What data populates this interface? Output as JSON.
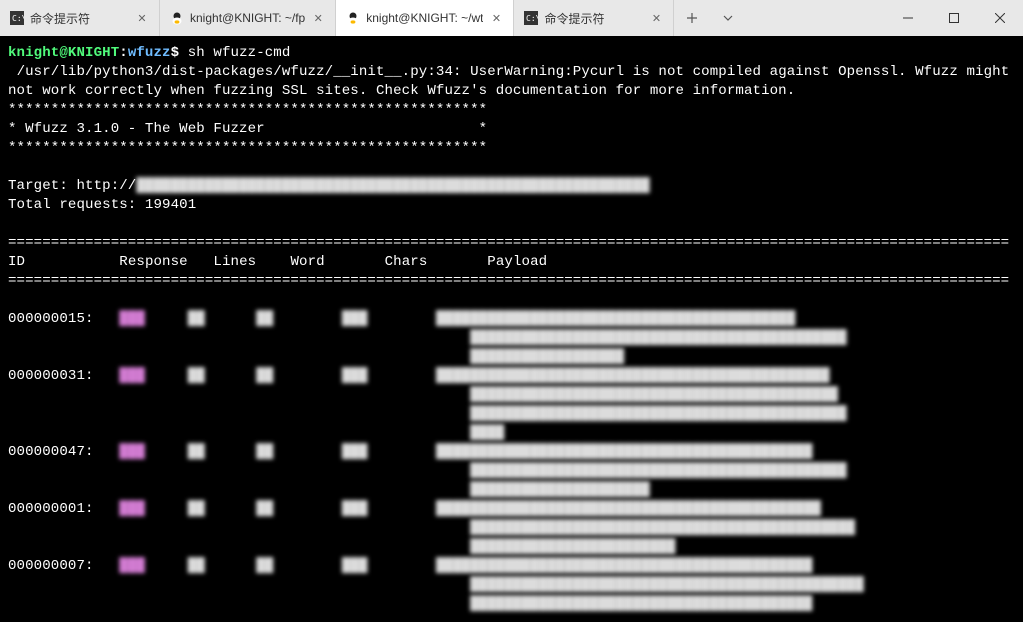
{
  "tabs": [
    {
      "icon": "cmd",
      "label": "命令提示符"
    },
    {
      "icon": "tux",
      "label": "knight@KNIGHT: ~/fp"
    },
    {
      "icon": "tux",
      "label": "knight@KNIGHT: ~/wt",
      "active": true
    },
    {
      "icon": "cmd",
      "label": "命令提示符"
    }
  ],
  "prompt": {
    "userhost": "knight@KNIGHT",
    "sep": ":",
    "path": "wfuzz",
    "dollar": "$",
    "cmd": "sh wfuzz-cmd"
  },
  "warning": " /usr/lib/python3/dist-packages/wfuzz/__init__.py:34: UserWarning:Pycurl is not compiled against Openssl. Wfuzz might not work correctly when fuzzing SSL sites. Check Wfuzz's documentation for more information.",
  "stars_line": "********************************************************",
  "banner_line": "* Wfuzz 3.1.0 - The Web Fuzzer                         *",
  "target_label": "Target: http://",
  "target_blur": "████████████████████████████████████████████████████████████",
  "total_requests": "Total requests: 199401",
  "hr_line": "=====================================================================================================================",
  "columns": {
    "id": "ID",
    "response": "Response",
    "lines": "Lines",
    "word": "Word",
    "chars": "Chars",
    "payload": "Payload"
  },
  "rows": [
    {
      "id": "000000015:",
      "response": "███",
      "lines": "██",
      "word": "██",
      "chars": "███",
      "payload_lines": [
        "██████████████████████████████████████████",
        "████████████████████████████████████████████",
        "██████████████████"
      ]
    },
    {
      "id": "000000031:",
      "response": "███",
      "lines": "██",
      "word": "██",
      "chars": "███",
      "payload_lines": [
        "██████████████████████████████████████████████",
        "███████████████████████████████████████████",
        "████████████████████████████████████████████",
        "████"
      ]
    },
    {
      "id": "000000047:",
      "response": "███",
      "lines": "██",
      "word": "██",
      "chars": "███",
      "payload_lines": [
        "████████████████████████████████████████████",
        "████████████████████████████████████████████",
        "█████████████████████"
      ]
    },
    {
      "id": "000000001:",
      "response": "███",
      "lines": "██",
      "word": "██",
      "chars": "███",
      "payload_lines": [
        "█████████████████████████████████████████████",
        "█████████████████████████████████████████████",
        "████████████████████████"
      ]
    },
    {
      "id": "000000007:",
      "response": "███",
      "lines": "██",
      "word": "██",
      "chars": "███",
      "payload_lines": [
        "████████████████████████████████████████████",
        "██████████████████████████████████████████████",
        "████████████████████████████████████████"
      ]
    }
  ]
}
